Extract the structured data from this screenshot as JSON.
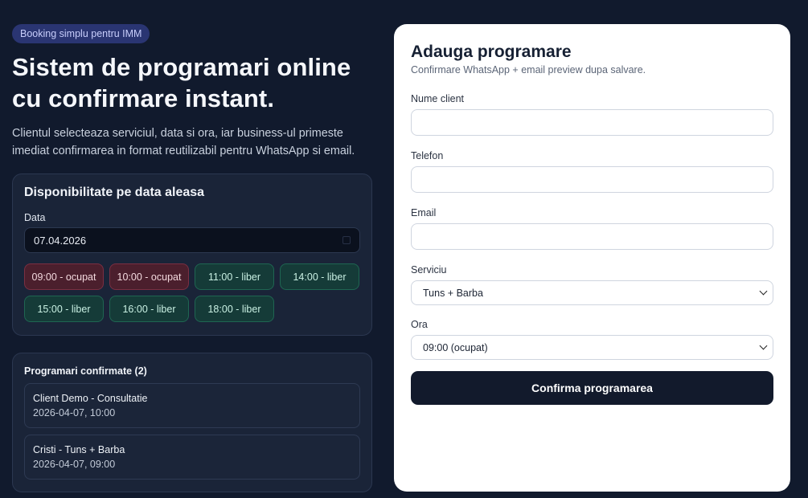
{
  "hero": {
    "badge": "Booking simplu pentru IMM",
    "title": "Sistem de programari online cu confirmare instant.",
    "description": "Clientul selecteaza serviciul, data si ora, iar business-ul primeste imediat confirmarea in format reutilizabil pentru WhatsApp si email."
  },
  "availability": {
    "title": "Disponibilitate pe data aleasa",
    "date_label": "Data",
    "date_value": "07.04.2026",
    "slots": [
      {
        "label": "09:00 - ocupat",
        "status": "busy"
      },
      {
        "label": "10:00 - ocupat",
        "status": "busy"
      },
      {
        "label": "11:00 - liber",
        "status": "free"
      },
      {
        "label": "14:00 - liber",
        "status": "free"
      },
      {
        "label": "15:00 - liber",
        "status": "free"
      },
      {
        "label": "16:00 - liber",
        "status": "free"
      },
      {
        "label": "18:00 - liber",
        "status": "free"
      }
    ]
  },
  "bookings": {
    "title": "Programari confirmate (2)",
    "items": [
      {
        "name": "Client Demo - Consultatie",
        "datetime": "2026-04-07, 10:00"
      },
      {
        "name": "Cristi - Tuns + Barba",
        "datetime": "2026-04-07, 09:00"
      }
    ]
  },
  "form": {
    "title": "Adauga programare",
    "subtitle": "Confirmare WhatsApp + email preview dupa salvare.",
    "name_label": "Nume client",
    "name_value": "",
    "phone_label": "Telefon",
    "phone_value": "",
    "email_label": "Email",
    "email_value": "",
    "service_label": "Serviciu",
    "service_value": "Tuns + Barba",
    "time_label": "Ora",
    "time_value": "09:00 (ocupat)",
    "submit_label": "Confirma programarea"
  },
  "colors": {
    "page_bg": "#111a2d",
    "busy_slot": "#4b1f2d",
    "free_slot": "#153b38",
    "badge_bg": "#2a3572",
    "submit_bg": "#121a2c"
  }
}
